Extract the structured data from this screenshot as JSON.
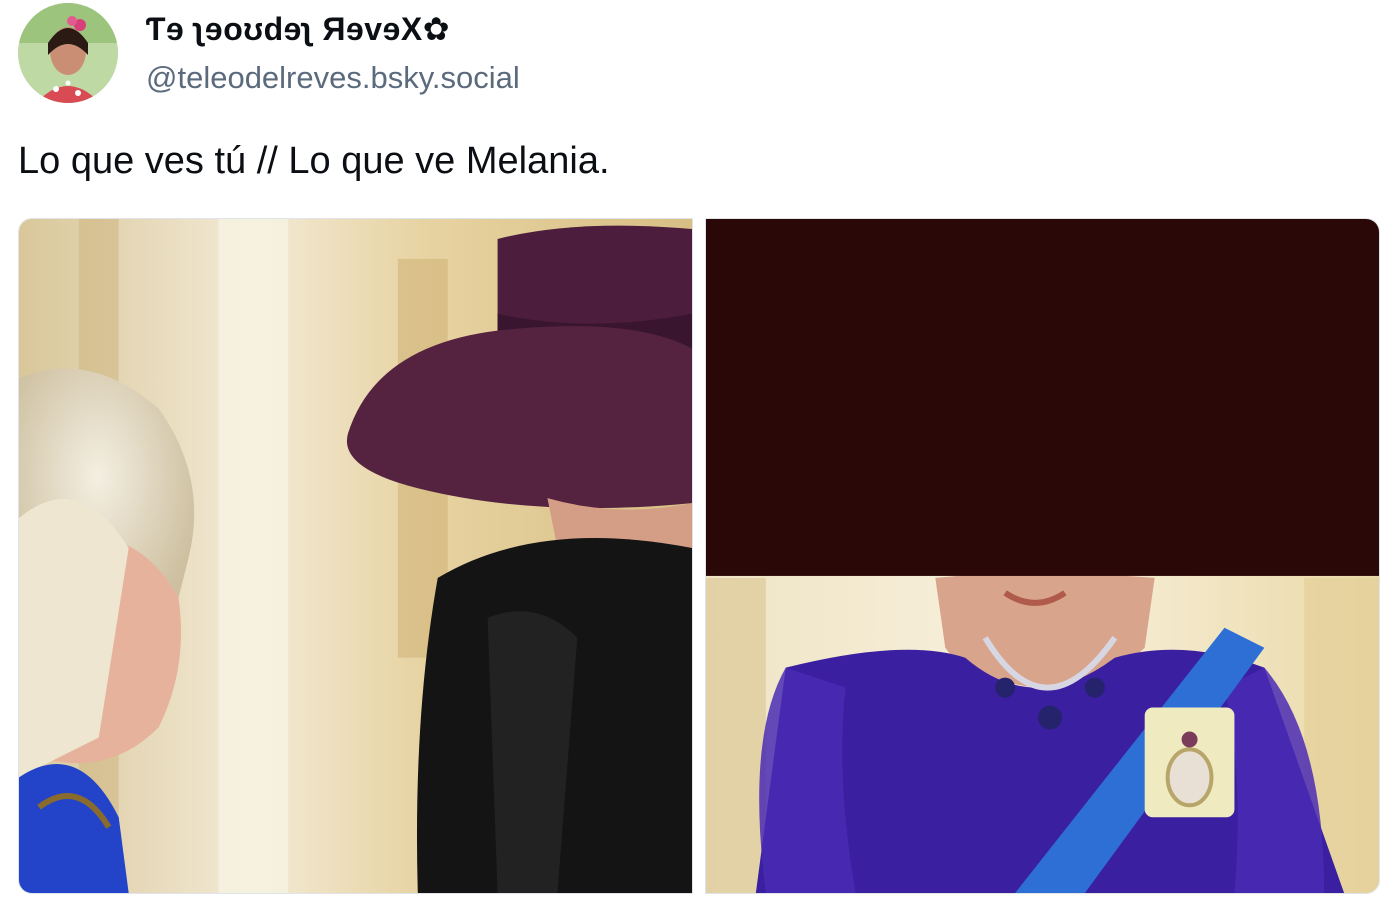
{
  "author": {
    "display_name": "Ƭɘ ʅɘoʊdɘʅ ЯɘvɘX✿",
    "handle": "@teleodelreves.bsky.social",
    "avatar_icon": "profile-photo-icon"
  },
  "post": {
    "text": "Lo que ves tú // Lo que ve Melania."
  },
  "images": [
    {
      "name": "photo-left",
      "icon": "photo-icon"
    },
    {
      "name": "photo-right",
      "icon": "photo-icon"
    }
  ],
  "colors": {
    "name_text": "#0b0f14",
    "handle_text": "#5b6b7d",
    "hat_purple": "#4e1f3e",
    "censor_bar": "#2a0808",
    "dress_blue": "#3a1fa0",
    "sash_blue": "#2e6fd6"
  }
}
